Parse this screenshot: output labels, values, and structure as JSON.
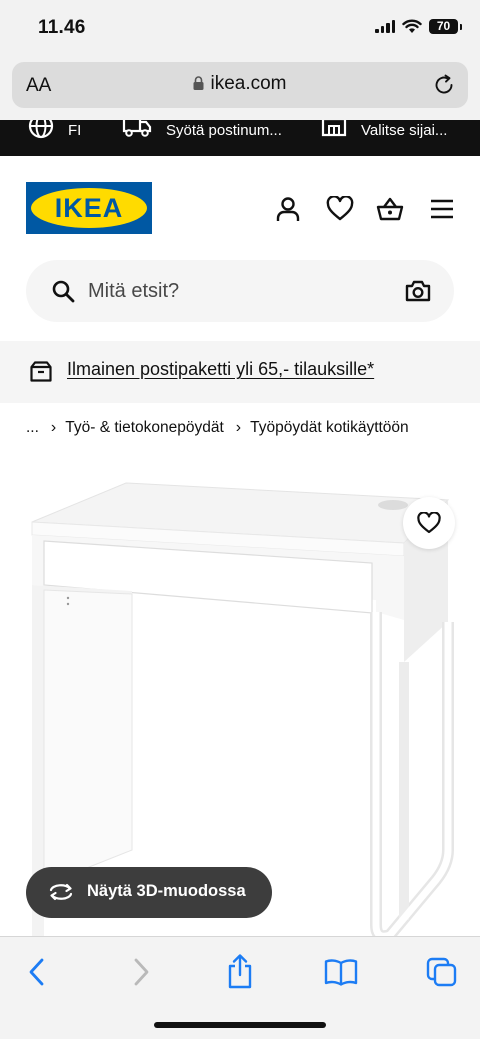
{
  "status_bar": {
    "time": "11.46",
    "battery": "70"
  },
  "browser": {
    "text_size_label": "AA",
    "url": "ikea.com"
  },
  "promo_bar": {
    "language": "FI",
    "postal_code": "Syötä postinum...",
    "store": "Valitse sijai..."
  },
  "header": {
    "logo_text": "IKEA"
  },
  "search": {
    "placeholder": "Mitä etsit?"
  },
  "shipping_banner": {
    "text": "Ilmainen postipaketti yli 65,- tilauksille*"
  },
  "breadcrumb": {
    "ellipsis": "...",
    "items": [
      "Työ- & tietokonepöydät",
      "Työpöydät kotikäyttöön"
    ]
  },
  "product": {
    "view_3d_label": "Näytä 3D-muodossa"
  },
  "colors": {
    "ikea_blue": "#0058a3",
    "ikea_yellow": "#ffdb00",
    "link_blue": "#1c7cf4"
  }
}
